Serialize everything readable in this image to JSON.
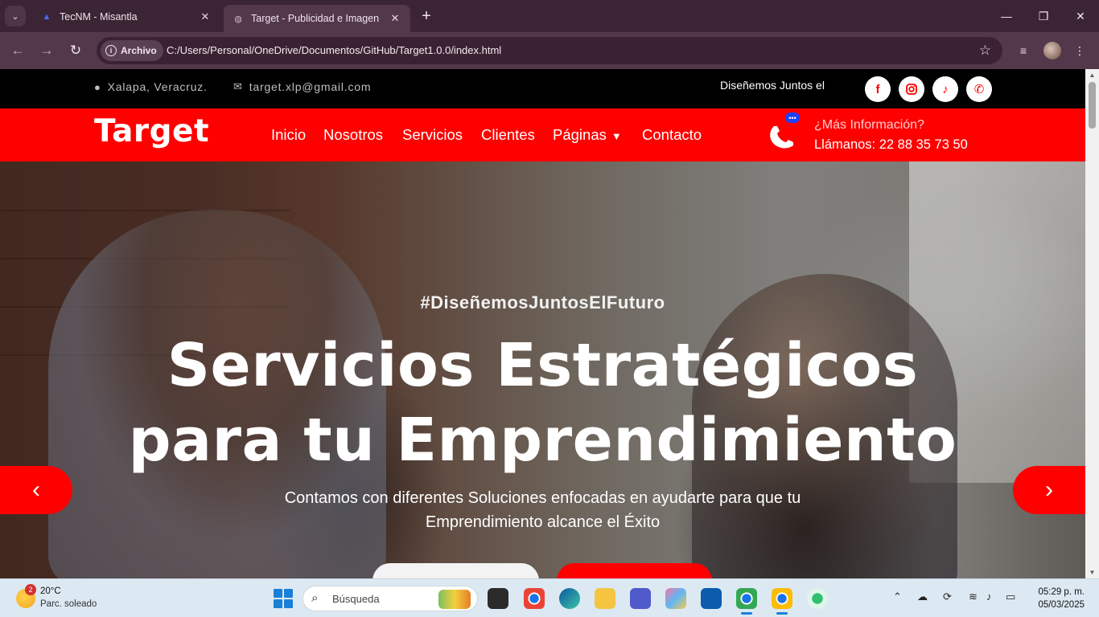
{
  "browser": {
    "tabs": [
      {
        "title": "TecNM - Misantla",
        "active": false
      },
      {
        "title": "Target - Publicidad e Imagen",
        "active": true
      }
    ],
    "security_chip": "Archivo",
    "url": "C:/Users/Personal/OneDrive/Documentos/GitHub/Target1.0.0/index.html"
  },
  "topbar": {
    "location": "Xalapa, Veracruz.",
    "email": "target.xlp@gmail.com",
    "marquee": "Diseñemos Juntos el",
    "social": [
      "facebook-icon",
      "instagram-icon",
      "tiktok-icon",
      "phone-icon"
    ]
  },
  "navbar": {
    "brand": "Target",
    "links": [
      "Inicio",
      "Nosotros",
      "Servicios",
      "Clientes",
      "Páginas",
      "Contacto"
    ],
    "call_subtitle": "¿Más Información?",
    "call_number": "Llámanos: 22 88 35 73 50"
  },
  "hero": {
    "tagline": "#DiseñemosJuntosElFuturo",
    "title_line1": "Servicios Estratégicos",
    "title_line2": "para tu Emprendimiento",
    "subtitle_line1": "Contamos con diferentes Soluciones enfocadas en ayudarte para que tu",
    "subtitle_line2": "Emprendimiento alcance el Éxito"
  },
  "taskbar": {
    "weather_badge": "2",
    "temperature": "20°C",
    "condition": "Parc. soleado",
    "search_placeholder": "Búsqueda",
    "time": "05:29 p. m.",
    "date": "05/03/2025"
  },
  "colors": {
    "brand_red": "#ff0000",
    "chrome_dark": "#3b2434",
    "chrome_toolbar": "#53384b"
  }
}
